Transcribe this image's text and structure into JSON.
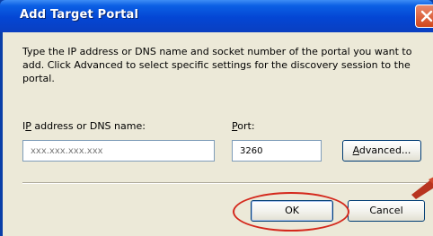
{
  "dialog": {
    "title": "Add Target Portal",
    "description": "Type the IP address or DNS name and socket number of the portal you want to add. Click Advanced to select specific settings for the discovery session to the portal."
  },
  "form": {
    "ip_label_prefix": "I",
    "ip_label_underlined": "P",
    "ip_label_rest": " address or DNS name:",
    "ip_value": "xxx.xxx.xxx.xxx",
    "port_label_underlined": "P",
    "port_label_rest": "ort:",
    "port_value": "3260"
  },
  "buttons": {
    "advanced_underlined": "A",
    "advanced_rest": "dvanced...",
    "ok_label": "OK",
    "cancel_label": "Cancel"
  },
  "colors": {
    "title_bar": "#0446d4",
    "dialog_background": "#ece9d8",
    "highlight_annotation": "#d4281c"
  },
  "icons": [
    "close-icon",
    "annotation-arrow"
  ]
}
